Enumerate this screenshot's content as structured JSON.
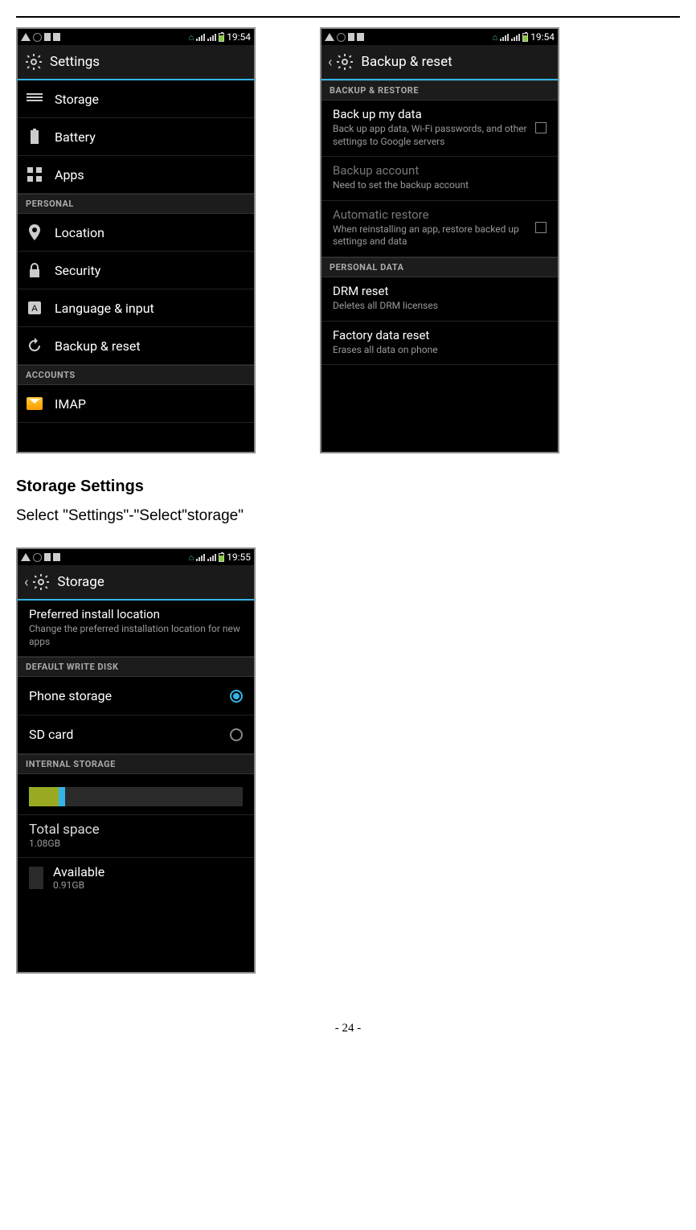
{
  "statusbar": {
    "time1": "19:54",
    "time2": "19:54",
    "time3": "19:55"
  },
  "screen1": {
    "title": "Settings",
    "items": {
      "storage": "Storage",
      "battery": "Battery",
      "apps": "Apps"
    },
    "section_personal": "PERSONAL",
    "personal": {
      "location": "Location",
      "security": "Security",
      "language": "Language & input",
      "backup": "Backup & reset"
    },
    "section_accounts": "ACCOUNTS",
    "accounts": {
      "imap": "IMAP"
    }
  },
  "screen2": {
    "title": "Backup & reset",
    "section_backup": "BACKUP & RESTORE",
    "backup_data": {
      "title": "Back up my data",
      "desc": "Back up app data, Wi-Fi passwords, and other settings to Google servers"
    },
    "backup_account": {
      "title": "Backup account",
      "desc": "Need to set the backup account"
    },
    "auto_restore": {
      "title": "Automatic restore",
      "desc": "When reinstalling an app, restore backed up settings and data"
    },
    "section_personal_data": "PERSONAL DATA",
    "drm": {
      "title": "DRM reset",
      "desc": "Deletes all DRM licenses"
    },
    "factory": {
      "title": "Factory data reset",
      "desc": "Erases all data on phone"
    }
  },
  "doc": {
    "heading": "Storage Settings",
    "text": "Select \"Settings\"-\"Select\"storage\"",
    "page": "- 24 -"
  },
  "screen3": {
    "title": "Storage",
    "pref": {
      "title": "Preferred install location",
      "desc": "Change the preferred installation location for new apps"
    },
    "section_default": "DEFAULT WRITE DISK",
    "radio1": "Phone storage",
    "radio2": "SD card",
    "section_internal": "INTERNAL STORAGE",
    "total": {
      "label": "Total space",
      "value": "1.08GB"
    },
    "available": {
      "label": "Available",
      "value": "0.91GB"
    }
  }
}
